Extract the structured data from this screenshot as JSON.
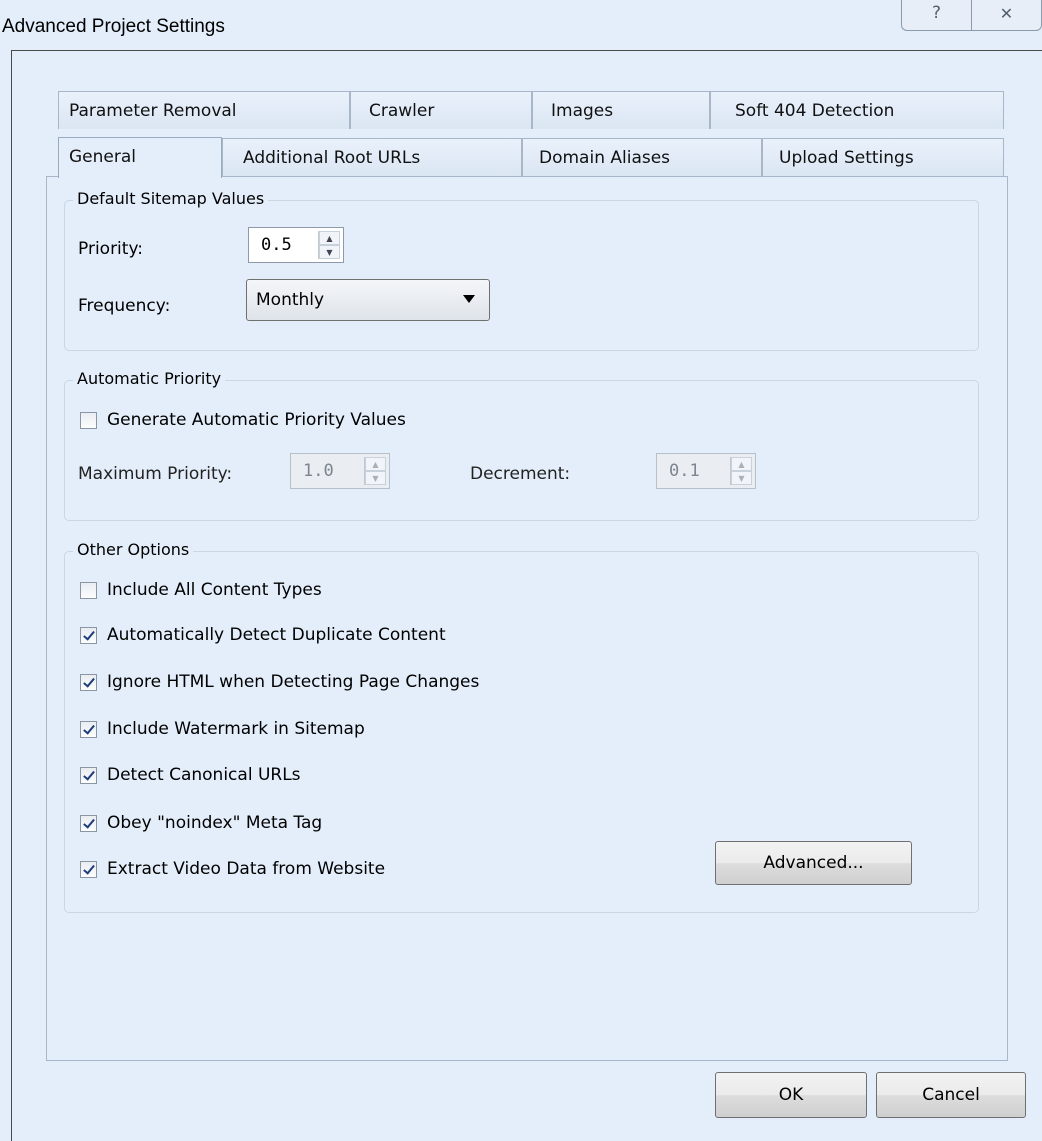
{
  "window": {
    "title": "Advanced Project Settings",
    "help_glyph": "?",
    "close_glyph": "✕"
  },
  "tabs": {
    "row1": [
      "Parameter Removal",
      "Crawler",
      "Images",
      "Soft 404 Detection"
    ],
    "row2": [
      "General",
      "Additional Root URLs",
      "Domain Aliases",
      "Upload Settings"
    ],
    "active": "General"
  },
  "default_sitemap": {
    "group_label": "Default Sitemap Values",
    "priority_label": "Priority:",
    "priority_value": "0.5",
    "frequency_label": "Frequency:",
    "frequency_value": "Monthly"
  },
  "automatic_priority": {
    "group_label": "Automatic Priority",
    "generate_label": "Generate Automatic Priority Values",
    "generate_checked": false,
    "max_label": "Maximum Priority:",
    "max_value": "1.0",
    "decrement_label": "Decrement:",
    "decrement_value": "0.1"
  },
  "other_options": {
    "group_label": "Other Options",
    "items": [
      {
        "label": "Include All Content Types",
        "checked": false
      },
      {
        "label": "Automatically Detect Duplicate Content",
        "checked": true
      },
      {
        "label": "Ignore HTML when Detecting Page Changes",
        "checked": true
      },
      {
        "label": "Include Watermark in Sitemap",
        "checked": true
      },
      {
        "label": "Detect Canonical URLs",
        "checked": true
      },
      {
        "label": "Obey \"noindex\" Meta Tag",
        "checked": true
      },
      {
        "label": "Extract Video Data from Website",
        "checked": true
      }
    ],
    "advanced_button": "Advanced..."
  },
  "footer": {
    "ok": "OK",
    "cancel": "Cancel"
  }
}
